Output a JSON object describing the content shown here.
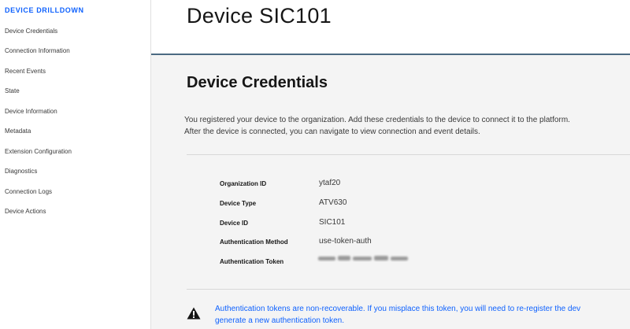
{
  "sidebar": {
    "heading": "DEVICE DRILLDOWN",
    "items": [
      {
        "label": "Device Credentials"
      },
      {
        "label": "Connection Information"
      },
      {
        "label": "Recent Events"
      },
      {
        "label": "State"
      },
      {
        "label": "Device Information"
      },
      {
        "label": "Metadata"
      },
      {
        "label": "Extension Configuration"
      },
      {
        "label": "Diagnostics"
      },
      {
        "label": "Connection Logs"
      },
      {
        "label": "Device Actions"
      }
    ]
  },
  "header": {
    "title": "Device SIC101"
  },
  "credentials": {
    "title": "Device Credentials",
    "description_line1": "You registered your device to the organization. Add these credentials to the device to connect it to the platform.",
    "description_line2": "After the device is connected, you can navigate to view connection and event details.",
    "rows": [
      {
        "label": "Organization ID",
        "value": "ytaf20"
      },
      {
        "label": "Device Type",
        "value": "ATV630"
      },
      {
        "label": "Device ID",
        "value": "SIC101"
      },
      {
        "label": "Authentication Method",
        "value": "use-token-auth"
      },
      {
        "label": "Authentication Token",
        "value": ""
      }
    ]
  },
  "warning": {
    "icon": "warning-icon",
    "line1": "Authentication tokens are non-recoverable. If you misplace this token, you will need to re-register the dev",
    "line2": "generate a new authentication token."
  },
  "colors": {
    "accent": "#0f62fe",
    "header_border": "#4b6a82"
  }
}
